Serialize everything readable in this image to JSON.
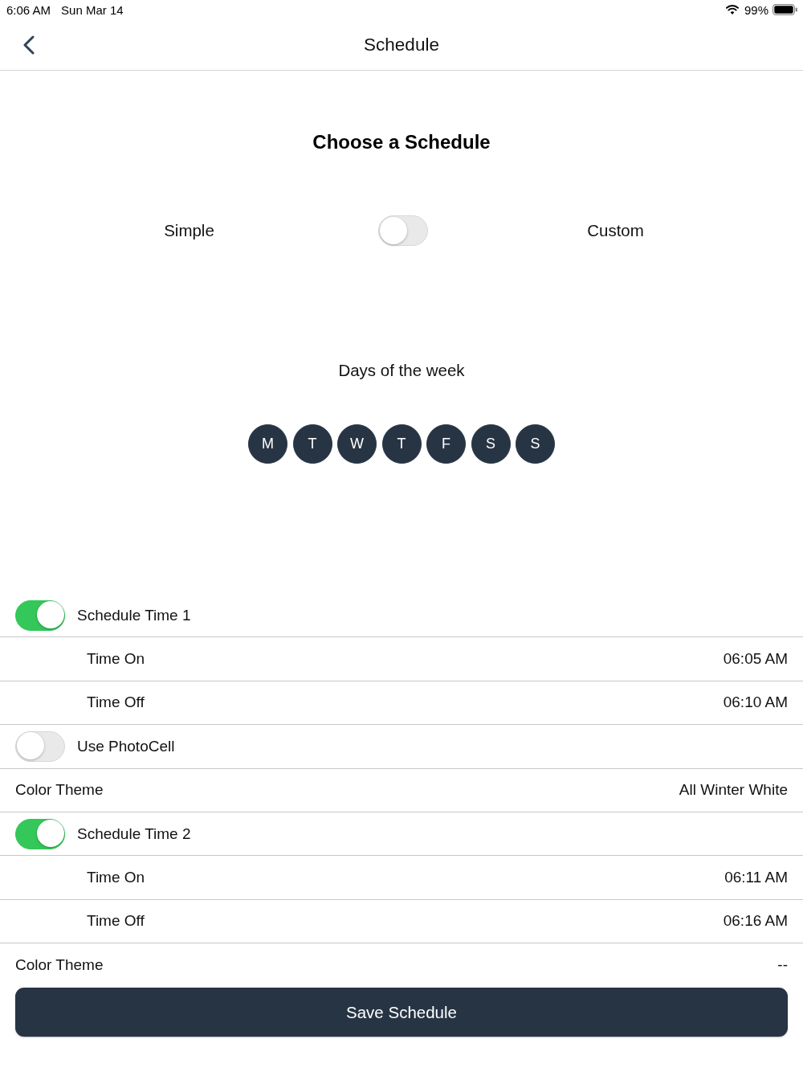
{
  "status_bar": {
    "time": "6:06 AM",
    "date": "Sun Mar 14",
    "battery": "99%"
  },
  "nav": {
    "title": "Schedule"
  },
  "heading": "Choose a Schedule",
  "mode": {
    "left_label": "Simple",
    "right_label": "Custom",
    "on": false
  },
  "days": {
    "label": "Days of the week",
    "items": [
      {
        "label": "M",
        "selected": true
      },
      {
        "label": "T",
        "selected": true
      },
      {
        "label": "W",
        "selected": true
      },
      {
        "label": "T",
        "selected": true
      },
      {
        "label": "F",
        "selected": true
      },
      {
        "label": "S",
        "selected": true
      },
      {
        "label": "S",
        "selected": true
      }
    ]
  },
  "rows": [
    {
      "kind": "toggle",
      "label": "Schedule Time 1",
      "on": true
    },
    {
      "kind": "detail",
      "label": "Time On",
      "value": "06:05 AM"
    },
    {
      "kind": "detail",
      "label": "Time Off",
      "value": "06:10 AM"
    },
    {
      "kind": "toggle",
      "label": "Use PhotoCell",
      "on": false
    },
    {
      "kind": "setting",
      "label": "Color Theme",
      "value": "All Winter White"
    },
    {
      "kind": "toggle",
      "label": "Schedule Time 2",
      "on": true
    },
    {
      "kind": "detail",
      "label": "Time On",
      "value": "06:11 AM"
    },
    {
      "kind": "detail",
      "label": "Time Off",
      "value": "06:16 AM"
    },
    {
      "kind": "setting",
      "label": "Color Theme",
      "value": "--"
    }
  ],
  "save_button": "Save Schedule"
}
